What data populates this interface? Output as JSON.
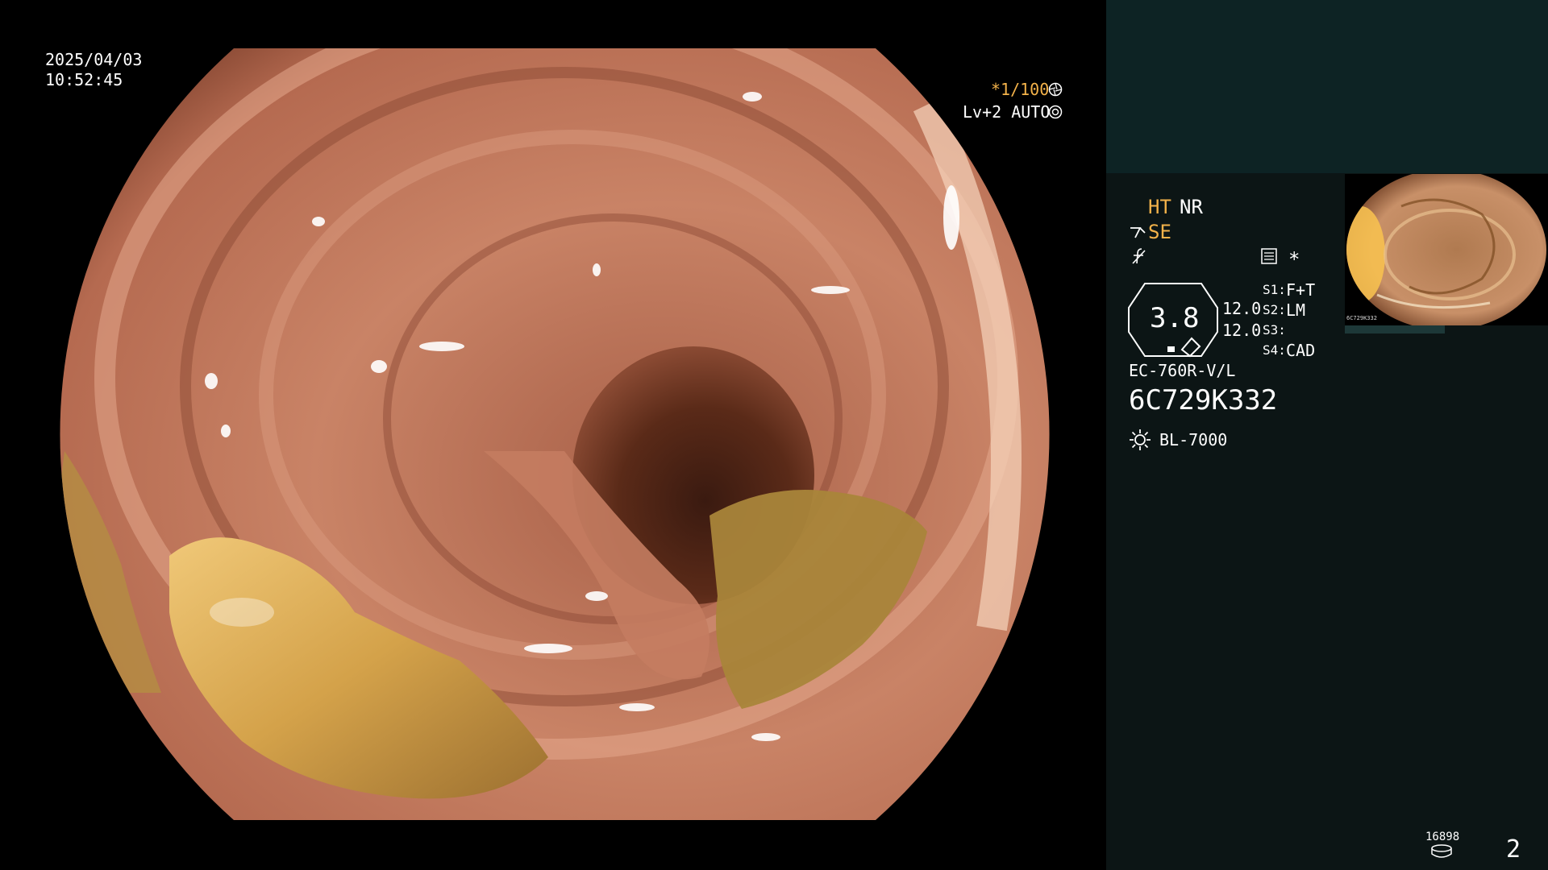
{
  "overlay": {
    "date": "2025/04/03",
    "time": "10:52:45",
    "shutter": "*1/100",
    "shutter_icon": "aperture-icon",
    "level": "Lv+2 AUTO",
    "level_icon": "target-icon"
  },
  "side": {
    "ht": "HT",
    "nr": "NR",
    "se": "SE",
    "s1_key": "S1:",
    "s1_val": "F+T",
    "s2_key": "S2:",
    "s2_val": "LM",
    "s3_key": "S3:",
    "s3_val": "",
    "s4_key": "S4:",
    "s4_val": "CAD",
    "gauge": "3.8",
    "gauge_top": "12.0",
    "gauge_bottom": "12.0",
    "scope_model": "EC-760R-V/L",
    "serial": "6C729K332",
    "light_source": "BL-7000",
    "light_icon": "sun-icon",
    "star": "*",
    "disk_count": "16898",
    "disk_icon": "disk-icon",
    "page_number": "2"
  },
  "thumbnail": {
    "caption_serial": "6C729K332"
  },
  "colors": {
    "accent_orange": "#f3b24a",
    "panel_bg": "#0c1515",
    "panel_top_bg": "#0d2324"
  }
}
